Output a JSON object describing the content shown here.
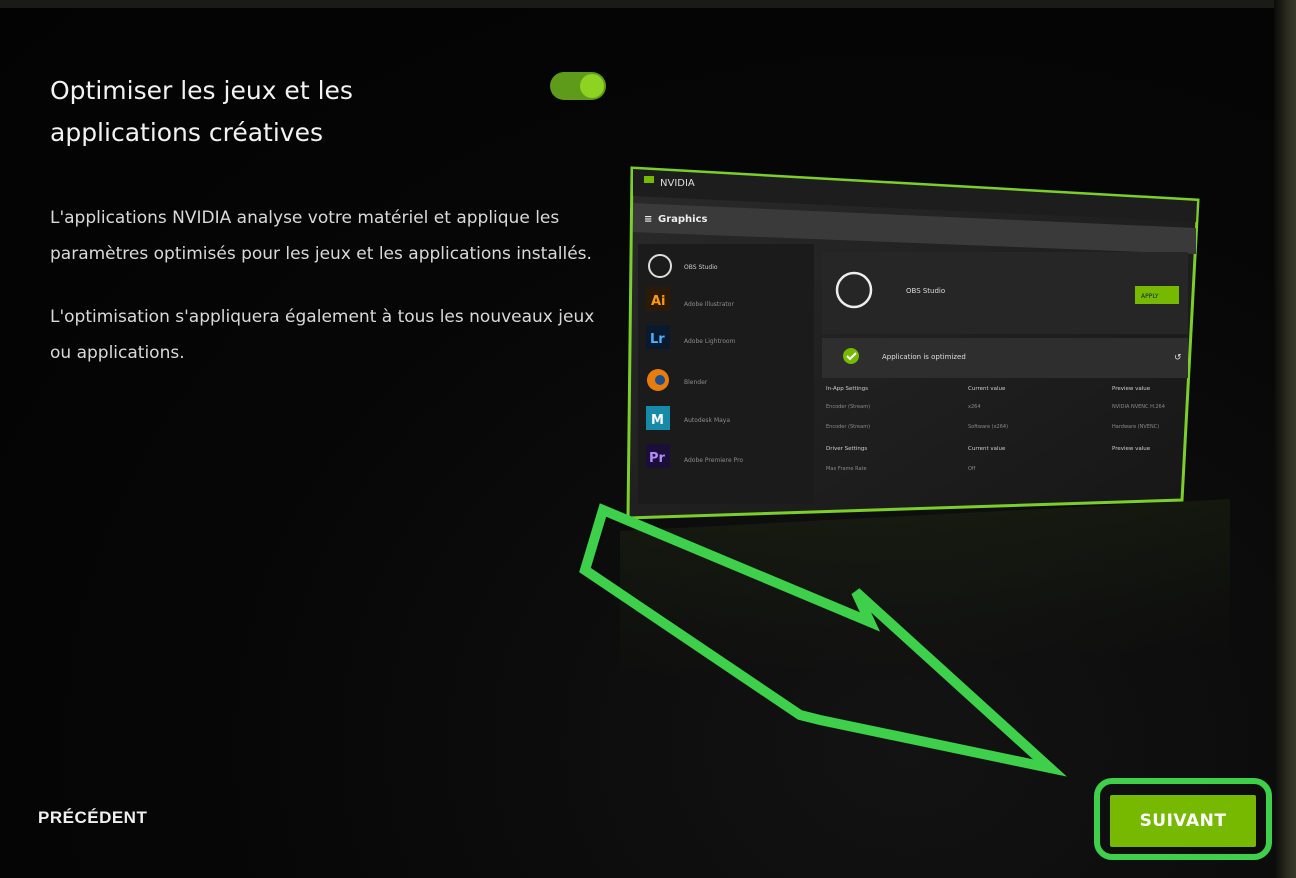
{
  "setting": {
    "title": "Optimiser les jeux et les applications créatives",
    "toggle_on": true,
    "description": [
      "L'applications NVIDIA analyse votre matériel et applique les paramètres optimisés pour les jeux et les applications installés.",
      "L'optimisation s'appliquera également à tous les nouveaux jeux ou applications."
    ]
  },
  "preview": {
    "brand": "NVIDIA",
    "section": "Graphics",
    "apps": [
      "OBS Studio",
      "Adobe Illustrator",
      "Adobe Lightroom",
      "Blender",
      "Autodesk Maya",
      "Adobe Premiere Pro"
    ],
    "app_icons": [
      "obs-icon",
      "ai-icon",
      "lr-icon",
      "blender-icon",
      "maya-icon",
      "pr-icon"
    ],
    "selected_app": "OBS Studio",
    "apply_label": "APPLY",
    "status": "Application is optimized",
    "table_headers": [
      "In-App Settings",
      "Current value",
      "Preview value"
    ],
    "rows": [
      [
        "Encoder (Stream)",
        "x264",
        "NVIDIA NVENC H.264"
      ],
      [
        "Encoder (Stream)",
        "Software (x264)",
        "Hardware (NVENC)"
      ]
    ],
    "driver_headers": [
      "Driver Settings",
      "Current value",
      "Preview value"
    ],
    "driver_rows": [
      [
        "Max Frame Rate",
        "Off",
        ""
      ]
    ]
  },
  "footer": {
    "prev_label": "PRÉCÉDENT",
    "next_label": "SUIVANT"
  },
  "colors": {
    "accent": "#76b900",
    "highlight": "#3ed04a"
  }
}
